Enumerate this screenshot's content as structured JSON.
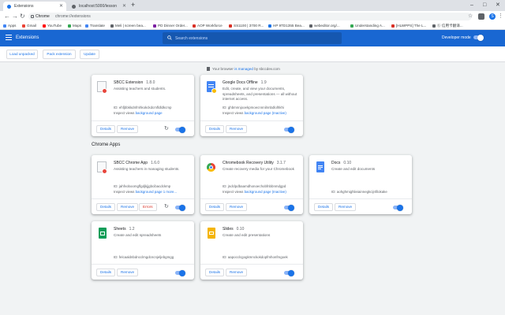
{
  "browser": {
    "tabs": [
      {
        "title": "Extensions",
        "active": true
      },
      {
        "title": "localhost:5000/lesson",
        "active": false
      }
    ],
    "window_controls": {
      "minimize": "–",
      "maximize": "□",
      "close": "✕"
    },
    "url": {
      "site": "Chrome",
      "path": "chrome://extensions"
    },
    "profile_initial": "S",
    "bookmarks": [
      {
        "label": "Apps",
        "color": "#4285f4"
      },
      {
        "label": "Gmail",
        "color": "#ea4335"
      },
      {
        "label": "YouTube",
        "color": "#ff0000"
      },
      {
        "label": "Maps",
        "color": "#34a853"
      },
      {
        "label": "Translate",
        "color": "#4285f4"
      },
      {
        "label": "Meli | screen bea...",
        "color": "#5f6368"
      },
      {
        "label": "PD Dinner Order...",
        "color": "#7b1fa2"
      },
      {
        "label": "AOP Workforce",
        "color": "#d93025"
      },
      {
        "label": "SS1100 | 3700 R...",
        "color": "#d93025"
      },
      {
        "label": "HP 9TD1355 Bea...",
        "color": "#1a73e8"
      },
      {
        "label": "webeditor.org/...",
        "color": "#5f6368"
      },
      {
        "label": "Understanding A...",
        "color": "#34a853"
      },
      {
        "label": "[HLWPPS] The L...",
        "color": "#d93025"
      },
      {
        "label": "ⓑ 信用卡翻译...",
        "color": "#5f6368"
      }
    ]
  },
  "header": {
    "title": "Extensions",
    "search_placeholder": "Search extensions",
    "dev_mode_label": "Developer mode"
  },
  "dev_toolbar": {
    "load_unpacked": "Load unpacked",
    "pack_extension": "Pack extension",
    "update": "Update"
  },
  "managed": {
    "prefix": "Your browser",
    "link": "is managed",
    "suffix": "by sbccdev.com"
  },
  "extensions": [
    {
      "name": "SBCC Extension",
      "version": "1.8.0",
      "description": "Assisting teachers and students.",
      "id": "ID: ehfjbbkkdnfmhkokckdcmfldldkcmp",
      "inspect_prefix": "Inspect views",
      "inspect_link": "background page",
      "details": "Details",
      "remove": "Remove"
    },
    {
      "name": "Google Docs Offline",
      "version": "1.9",
      "description": "Edit, create, and view your documents, spreadsheets, and presentations — all without internet access.",
      "id": "ID: ghbmnnjooekpmoecnnnilnnbdlolhkhi",
      "inspect_prefix": "Inspect views",
      "inspect_link": "background page (Inactive)",
      "details": "Details",
      "remove": "Remove"
    }
  ],
  "apps_section_title": "Chrome Apps",
  "apps": [
    {
      "name": "SBCC Chrome App",
      "version": "1.6.0",
      "description": "Assisting teachers in managing students.",
      "id": "ID: jahfvoboomgflgdjkjjgbcibacdckmp",
      "inspect_prefix": "Inspect views",
      "inspect_link": "background page",
      "inspect_more": "1 more...",
      "details": "Details",
      "remove": "Remove",
      "errors": "Errors"
    },
    {
      "name": "Chromebook Recovery Utility",
      "version": "3.1.7",
      "description": "Create recovery media for your Chromebook",
      "id": "ID: jndclpdbaamdhonoechobfnbbnmdgpd",
      "inspect_prefix": "Inspect views",
      "inspect_link": "background page (Inactive)",
      "details": "Details",
      "remove": "Remove"
    },
    {
      "name": "Docs",
      "version": "0.10",
      "description": "Create and edit documents",
      "id": "ID: aohghmighlieiainnegkcijnfilokake",
      "details": "Details",
      "remove": "Remove"
    },
    {
      "name": "Sheets",
      "version": "1.2",
      "description": "Create and edit spreadsheets",
      "id": "ID: felcaaldnbdncclmgdcncnjeljebgmgg",
      "details": "Details",
      "remove": "Remove"
    },
    {
      "name": "Slides",
      "version": "0.10",
      "description": "Create and edit presentations",
      "id": "ID: aapocclcgogkmnckokdopfmhonfmgoek",
      "details": "Details",
      "remove": "Remove"
    }
  ],
  "colors": {
    "header_blue": "#1967d2",
    "link_blue": "#1a73e8",
    "error_red": "#d93025",
    "toggle_track": "#8ab4f8"
  }
}
